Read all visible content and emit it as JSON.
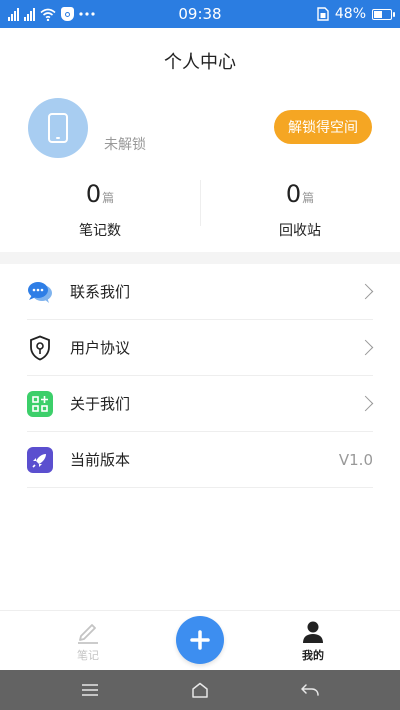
{
  "status_bar": {
    "time": "09:38",
    "battery_text": "48%",
    "battery_level": 0.48,
    "icons": [
      "signal-icon",
      "signal-icon",
      "wifi-icon",
      "shield-icon",
      "more-icon",
      "sim-icon",
      "battery-icon"
    ]
  },
  "header": {
    "title": "个人中心"
  },
  "profile": {
    "avatar_icon": "phone-icon",
    "lock_status": "未解锁",
    "unlock_button": "解锁得空间"
  },
  "stats": [
    {
      "value": "0",
      "unit": "篇",
      "label": "笔记数"
    },
    {
      "value": "0",
      "unit": "篇",
      "label": "回收站"
    }
  ],
  "menu": [
    {
      "label": "联系我们",
      "icon": "chat-bubbles-icon"
    },
    {
      "label": "用户协议",
      "icon": "shield-icon"
    },
    {
      "label": "关于我们",
      "icon": "apps-icon"
    },
    {
      "label": "当前版本",
      "icon": "rocket-icon",
      "value": "V1.0"
    }
  ],
  "tab_bar": {
    "notes_label": "笔记",
    "mine_label": "我的",
    "add_icon": "plus-icon"
  },
  "nav_bar": {
    "icons": [
      "menu-icon",
      "home-icon",
      "back-icon"
    ]
  },
  "colors": {
    "status_bar": "#2b7de1",
    "accent_orange": "#f5a623",
    "fab_blue": "#3d8ef0",
    "avatar_bg": "#a8cdf1",
    "nav_bar": "#636363"
  }
}
